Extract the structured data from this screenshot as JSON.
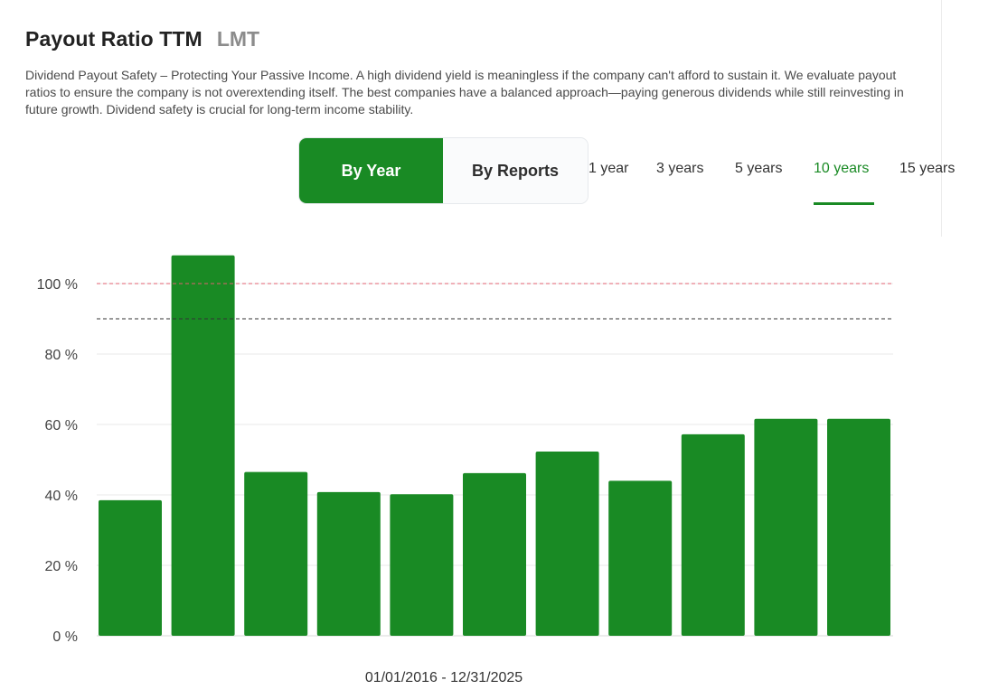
{
  "header": {
    "title": "Payout Ratio TTM",
    "ticker": "LMT"
  },
  "description": "Dividend Payout Safety – Protecting Your Passive Income. A high dividend yield is meaningless if the company can't afford to sustain it. We evaluate payout ratios to ensure the company is not overextending itself. The best companies have a balanced approach—paying generous dividends while still reinvesting in future growth. Dividend safety is crucial for long-term income stability.",
  "view_toggle": {
    "options": [
      "By Year",
      "By Reports"
    ],
    "selected": "By Year"
  },
  "periods": {
    "options": [
      "1 year",
      "3 years",
      "5 years",
      "10 years",
      "15 years"
    ],
    "selected": "10 years"
  },
  "colors": {
    "accent": "#198a24",
    "bar": "#198a24",
    "danger_line": "#e06070",
    "warning_line": "#333333",
    "grid": "#e8e8e8"
  },
  "chart_data": {
    "type": "bar",
    "values": [
      38.5,
      108,
      46.5,
      40.8,
      40.2,
      46.2,
      52.3,
      44,
      57.2,
      61.6,
      61.6
    ],
    "ylim": [
      0,
      110
    ],
    "y_ticks": [
      0,
      20,
      40,
      60,
      80,
      100
    ],
    "y_tick_labels": [
      "0 %",
      "20 %",
      "40 %",
      "60 %",
      "80 %",
      "100 %"
    ],
    "reference_lines": [
      {
        "value": 100,
        "style": "dashed",
        "color": "#e06070"
      },
      {
        "value": 90,
        "style": "dashed",
        "color": "#333333"
      }
    ],
    "grid": true,
    "date_range_label": "01/01/2016 - 12/31/2025"
  }
}
